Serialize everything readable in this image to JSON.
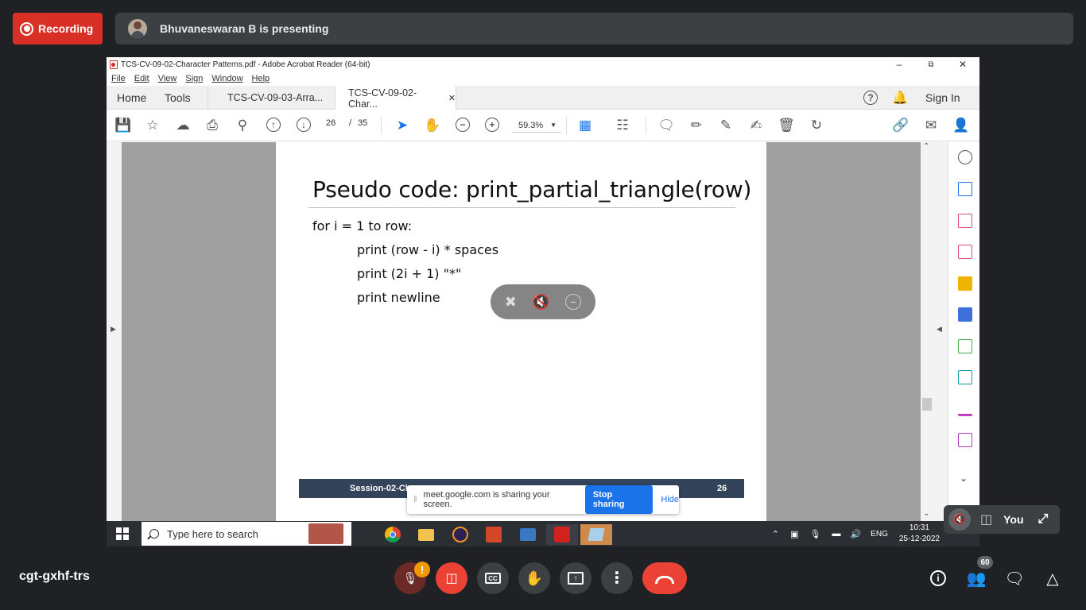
{
  "meet": {
    "recording_label": "Recording",
    "presenting_text": "Bhuvaneswaran B is presenting",
    "meeting_code": "cgt-gxhf-trs",
    "self_label": "You",
    "people_count": "60",
    "mic_warning": "!"
  },
  "acrobat": {
    "window_title": "TCS-CV-09-02-Character Patterns.pdf - Adobe Acrobat Reader (64-bit)",
    "menu": [
      "File",
      "Edit",
      "View",
      "Sign",
      "Window",
      "Help"
    ],
    "tab_home": "Home",
    "tab_tools": "Tools",
    "doc_tabs": [
      "TCS-CV-09-03-Arra...",
      "TCS-CV-09-02-Char..."
    ],
    "sign_in": "Sign In",
    "page_current": "26",
    "page_sep": "/",
    "page_total": "35",
    "zoom": "59.3%"
  },
  "slide": {
    "title": "Pseudo code: print_partial_triangle(row)",
    "lines": [
      "for i = 1 to row:",
      "print (row - i) * spaces",
      "print (2i + 1) \"*\"",
      "print newline"
    ],
    "footer_left": "Session-02-Cha",
    "footer_right": "26"
  },
  "share_banner": {
    "text": "meet.google.com is sharing your screen.",
    "stop_label": "Stop sharing",
    "hide_label": "Hide"
  },
  "taskbar": {
    "search_placeholder": "Type here to search",
    "lang": "ENG",
    "time": "10:31",
    "date": "25-12-2022"
  },
  "colors": {
    "meet_bg": "#202124",
    "record_red": "#d93025",
    "stop_blue": "#1a73e8",
    "footer_navy": "#33445a"
  }
}
